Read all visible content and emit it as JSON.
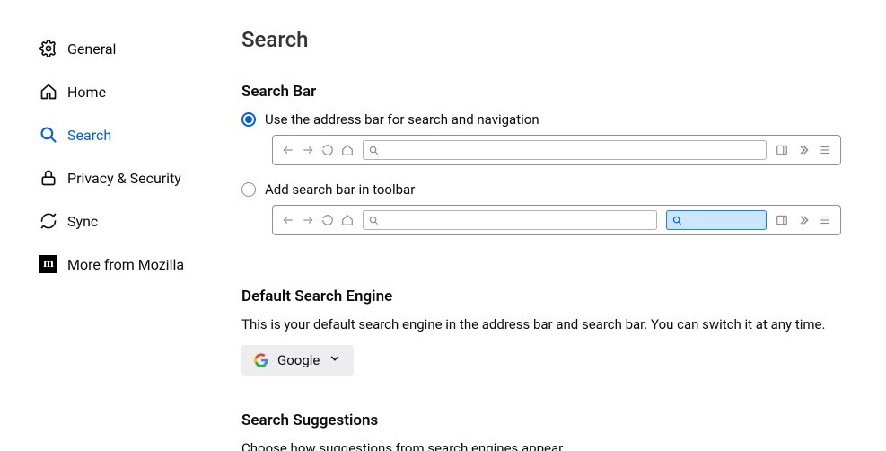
{
  "sidebar": {
    "items": [
      {
        "label": "General"
      },
      {
        "label": "Home"
      },
      {
        "label": "Search"
      },
      {
        "label": "Privacy & Security"
      },
      {
        "label": "Sync"
      },
      {
        "label": "More from Mozilla"
      }
    ]
  },
  "page": {
    "title": "Search"
  },
  "searchBar": {
    "heading": "Search Bar",
    "option1": "Use the address bar for search and navigation",
    "option2": "Add search bar in toolbar"
  },
  "defaultEngine": {
    "heading": "Default Search Engine",
    "desc": "This is your default search engine in the address bar and search bar. You can switch it at any time.",
    "selected": "Google"
  },
  "suggestions": {
    "heading": "Search Suggestions",
    "desc": "Choose how suggestions from search engines appear."
  }
}
